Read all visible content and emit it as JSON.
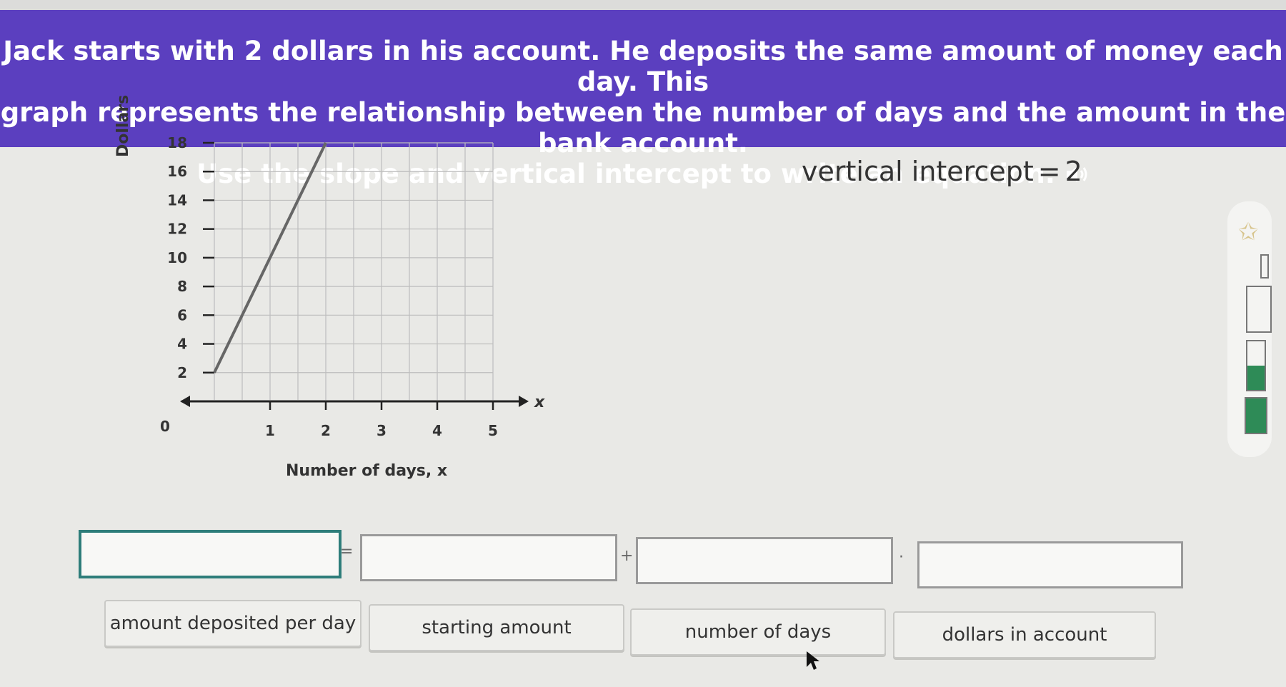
{
  "prompt": {
    "line1": "Jack starts with 2 dollars in his account. He deposits the same amount of money each day. This",
    "line2": "graph represents the relationship between the number of days and the amount in the bank account.",
    "line3": "Use the slope and vertical intercept to write an equation."
  },
  "graph": {
    "ylabel": "Dollars",
    "xlabel": "Number of days, x",
    "x_axis_letter": "x",
    "origin_label": "0",
    "x_ticks": [
      "1",
      "2",
      "3",
      "4",
      "5"
    ],
    "y_ticks": [
      "2",
      "4",
      "6",
      "8",
      "10",
      "12",
      "14",
      "16",
      "18"
    ]
  },
  "chart_data": {
    "type": "line",
    "x": [
      0,
      1,
      2
    ],
    "y": [
      2,
      10,
      18
    ],
    "xlabel": "Number of days, x",
    "ylabel": "Dollars",
    "xlim": [
      0,
      5
    ],
    "ylim": [
      0,
      18
    ],
    "grid": true
  },
  "info": {
    "vertical_intercept_label": "vertical intercept",
    "equals": "=",
    "vertical_intercept_value": "2"
  },
  "equation": {
    "equals": "=",
    "plus": "+",
    "dot": "·"
  },
  "choices": [
    "amount deposited per day",
    "starting amount",
    "number of days",
    "dollars in account"
  ],
  "colors": {
    "banner": "#5b3fbf",
    "progress_fill": "#2e8b57",
    "active_blank_border": "#2e7d7a"
  },
  "icons": [
    "speaker-icon",
    "star-icon",
    "mouse-pointer-icon"
  ]
}
